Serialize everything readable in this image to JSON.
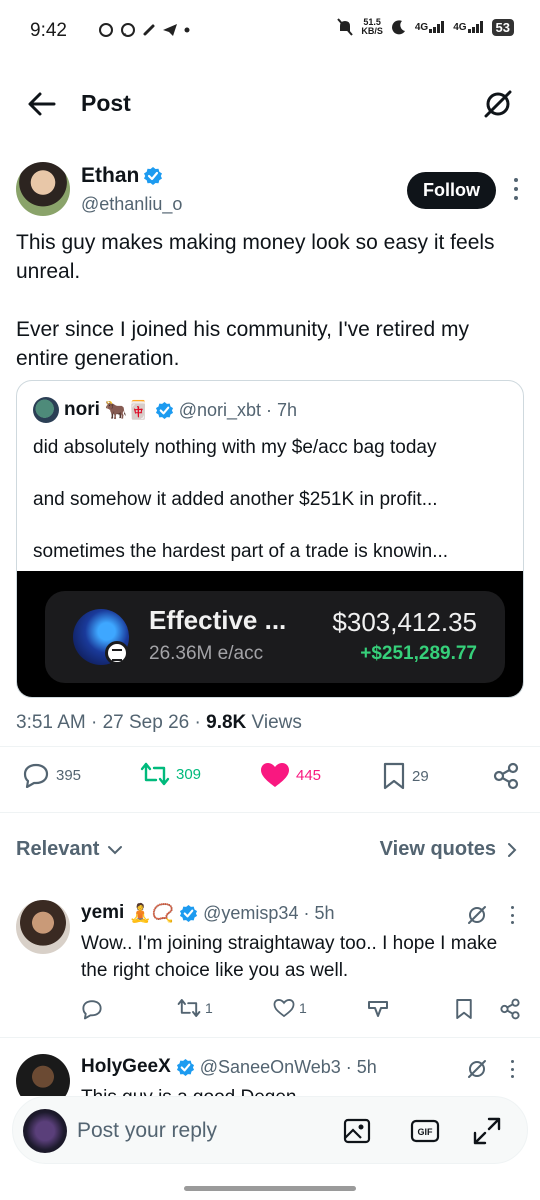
{
  "status_bar": {
    "time": "9:42",
    "speed_value": "51.5",
    "speed_unit": "KB/S",
    "network_1": "4G",
    "network_2": "4G",
    "battery": "53"
  },
  "header": {
    "title": "Post"
  },
  "post": {
    "author_name": "Ethan",
    "author_handle": "@ethanliu_o",
    "follow_label": "Follow",
    "paragraph_1": "This guy makes making money look so easy it feels unreal.",
    "paragraph_2": "Ever since I joined his community, I've retired my entire generation.",
    "timestamp": "3:51 AM · 27 Sep 26 · ",
    "views_count": "9.8K",
    "views_label": " Views",
    "stats": {
      "replies": "395",
      "reposts": "309",
      "likes": "445",
      "bookmarks": "29"
    },
    "like_color": "#f91880",
    "repost_color": "#00ba7c"
  },
  "quote": {
    "name": "nori",
    "emojis": "🐂🀄",
    "handle_time": "@nori_xbt · 7h",
    "line_1": "did absolutely nothing with my $e/acc bag today",
    "line_2": "and somehow it added another $251K in profit...",
    "line_3": "sometimes the hardest part of a trade is knowin...",
    "card": {
      "coin_name": "Effective ...",
      "quantity": "26.36M e/acc",
      "value": "$303,412.35",
      "profit": "+$251,289.77"
    }
  },
  "sort": {
    "label": "Relevant",
    "view_quotes": "View quotes"
  },
  "replies": [
    {
      "name": "yemi",
      "emojis": "🧘📿",
      "handle_time": "@yemisp34 · 5h",
      "text": "Wow.. I'm joining straightaway too.. I hope I make the right choice like you as well.",
      "reposts": "1",
      "likes": "1"
    },
    {
      "name": "HolyGeeX",
      "handle_time": "@SaneeOnWeb3 · 5h",
      "text": "This guy is a good Degen"
    }
  ],
  "reply_bar": {
    "placeholder": "Post your reply"
  },
  "verified_color": "#1d9bf0"
}
